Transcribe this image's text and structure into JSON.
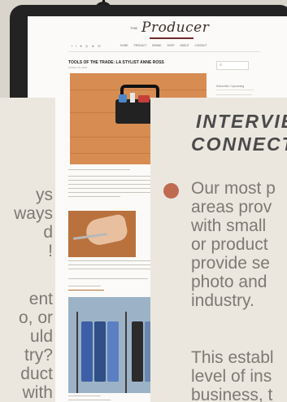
{
  "site": {
    "brand_prefix": "THE",
    "logo": "Producer",
    "social_icons": "f t ♥ ◎ ★ ✉",
    "nav": [
      "HOME",
      "PRODUCT",
      "BRAND",
      "SHOP",
      "ABOUT",
      "CONTACT"
    ],
    "post_title": "TOOLS OF THE TRADE: LA STYLIST ANNE ROSS",
    "post_date": "October 15, 2015",
    "sidebar_title": "Subscribe / Upcoming"
  },
  "left_slide": {
    "lines": [
      "ys",
      "ways",
      "d",
      "!",
      "",
      "ent",
      "o, or",
      "uld",
      "try?",
      "duct",
      "with"
    ]
  },
  "right_slide": {
    "heading_lines": [
      "INTERVIEW",
      "CONNECT"
    ],
    "body_lines": [
      "Our most p",
      "areas prov",
      "with small",
      "or product",
      "provide se",
      "photo and",
      "industry."
    ],
    "body_lines_2": [
      "This establ",
      "level of ins",
      "business, t"
    ],
    "bullet_color": "#be6b52"
  },
  "colors": {
    "background": "#ebe7df",
    "text_gray": "#7e7972",
    "heading": "#4a4a4a",
    "device": "#232323"
  }
}
